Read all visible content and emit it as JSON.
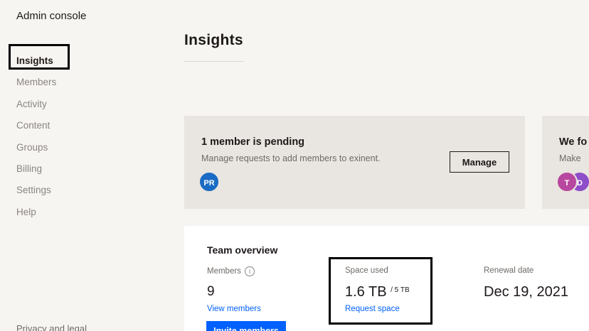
{
  "sidebar": {
    "title": "Admin console",
    "items": [
      {
        "label": "Insights"
      },
      {
        "label": "Members"
      },
      {
        "label": "Activity"
      },
      {
        "label": "Content"
      },
      {
        "label": "Groups"
      },
      {
        "label": "Billing"
      },
      {
        "label": "Settings"
      },
      {
        "label": "Help"
      }
    ],
    "footer_link": "Privacy and legal"
  },
  "main": {
    "title": "Insights",
    "pending_card": {
      "heading": "1 member is pending",
      "subtitle": "Manage requests to add members to exinent.",
      "button_label": "Manage",
      "avatar_initials": "PR"
    },
    "second_card": {
      "heading": "We fo",
      "subtitle": "Make",
      "avatars": [
        {
          "initials": "T"
        },
        {
          "initials": "D"
        }
      ]
    },
    "team_overview": {
      "title": "Team overview",
      "members": {
        "label": "Members",
        "value": "9",
        "link": "View members",
        "button": "Invite members"
      },
      "space": {
        "label": "Space used",
        "value": "1.6 TB",
        "total": "/ 5 TB",
        "link": "Request space"
      },
      "renewal": {
        "label": "Renewal date",
        "value": "Dec 19, 2021"
      }
    }
  },
  "colors": {
    "accent": "#0061fe",
    "avatar_pr": "#1a6bc4",
    "avatar_t": "#b8479f",
    "avatar_d": "#8e4dc9"
  }
}
